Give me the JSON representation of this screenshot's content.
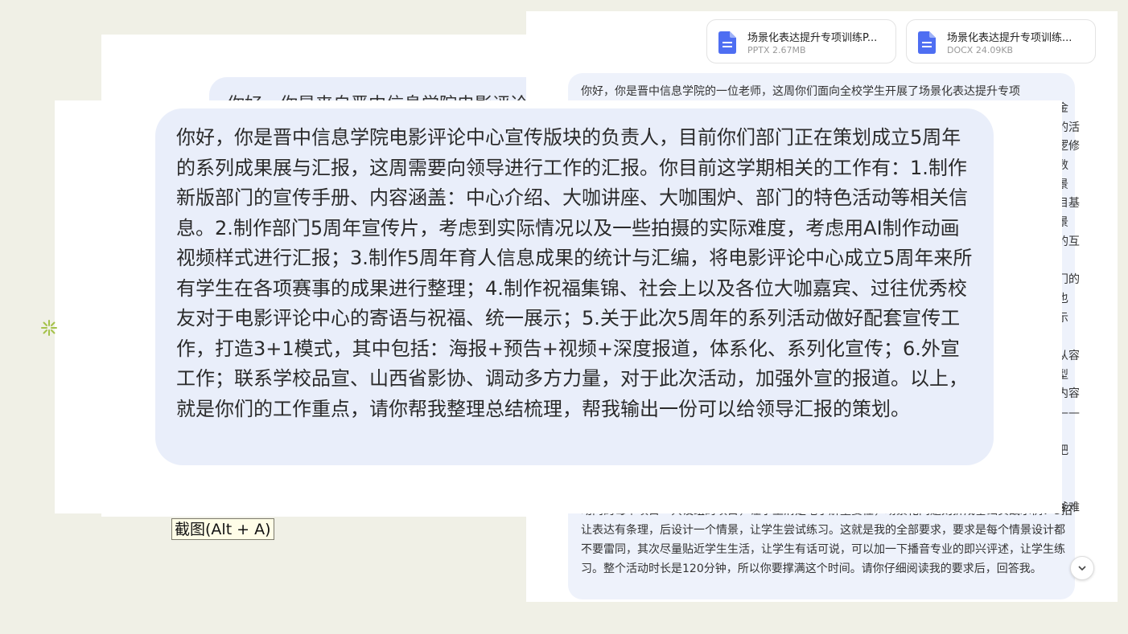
{
  "back_left": {
    "bubble_text": "你好，你是来自晋中信息学院电影评论"
  },
  "attachments": [
    {
      "name": "场景化表达提升专项训练P...",
      "meta": "PPTX 2.67MB"
    },
    {
      "name": "场景化表达提升专项训练...",
      "meta": "DOCX 24.09KB"
    }
  ],
  "right_chat": {
    "top_line": "你好，你是晋中信息学院的一位老师，这周你们面向全校学生开展了场景化表达提升专项",
    "right_fragments": [
      "金",
      "的活",
      "逻修",
      "数",
      "景",
      "目基",
      "景",
      "的互",
      "：",
      "门的",
      "也",
      "示",
      "",
      "从容",
      "型",
      "内容",
      "——",
      "：",
      "把",
      "",
      "",
      "斧难"
    ],
    "bottom_lines": "动内的每个项目一共设组的项目，让学生清楚地了解重要性，场景化问题则拆成基础实战示例：3招让表达有条理，后设计一个情景，让学生尝试练习。这就是我的全部要求，要求是每个情景设计都不要雷同，其次尽量贴近学生生活，让学生有话可说，可以加一下播音专业的即兴评述，让学生练习。整个活动时长是120分钟，所以你要撑满这个时间。请你仔细阅读我的要求后，回答我。"
  },
  "front_message": "你好，你是晋中信息学院电影评论中心宣传版块的负责人，目前你们部门正在策划成立5周年的系列成果展与汇报，这周需要向领导进行工作的汇报。你目前这学期相关的工作有：1.制作新版部门的宣传手册、内容涵盖：中心介绍、大咖讲座、大咖围炉、部门的特色活动等相关信息。2.制作部门5周年宣传片，考虑到实际情况以及一些拍摄的实际难度，考虑用AI制作动画视频样式进行汇报；3.制作5周年育人信息成果的统计与汇编，将电影评论中心成立5周年来所有学生在各项赛事的成果进行整理；4.制作祝福集锦、社会上以及各位大咖嘉宾、过往优秀校友对于电影评论中心的寄语与祝福、统一展示；5.关于此次5周年的系列活动做好配套宣传工作，打造3+1模式，其中包括：海报+预告+视频+深度报道，体系化、系列化宣传；6.外宣工作；联系学校品宣、山西省影协、调动多方力量，对于此次活动，加强外宣的报道。以上，就是你们的工作重点，请你帮我整理总结梳理，帮我输出一份可以给领导汇报的策划。",
  "capture_tooltip": "截图(Alt + A)",
  "icons": {
    "doc": "document-icon",
    "scroll": "chevron-down-icon",
    "sparkle": "sparkle-icon"
  },
  "colors": {
    "doc_icon": "#4e6ef2",
    "bubble": "#e9eefa",
    "background": "#f0f0e6",
    "sparkle": "#a5c24a"
  }
}
